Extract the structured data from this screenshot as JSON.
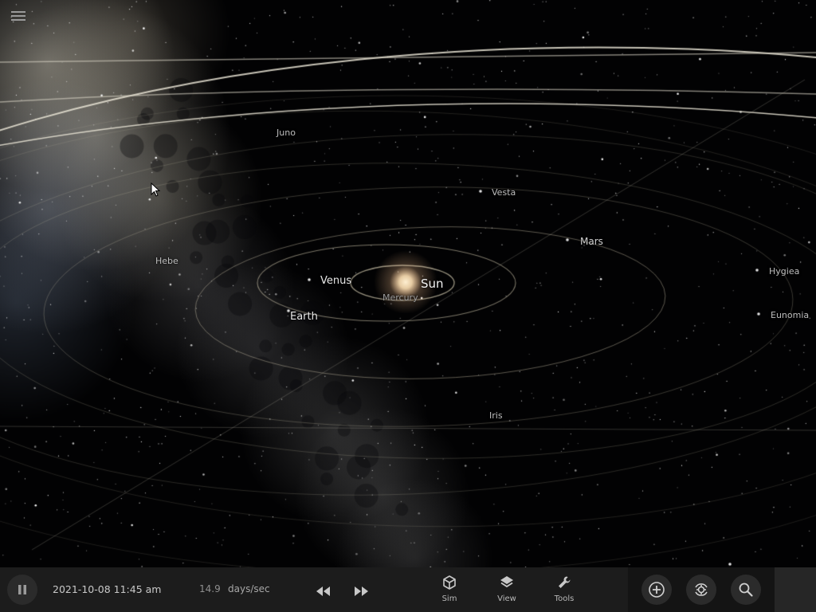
{
  "sky": {
    "labels": {
      "sun": "Sun",
      "mercury": "Mercury",
      "venus": "Venus",
      "earth": "Earth",
      "mars": "Mars",
      "vesta": "Vesta",
      "juno": "Juno",
      "hebe": "Hebe",
      "hygiea": "Hygiea",
      "eunomia": "Eunomia",
      "iris": "Iris"
    }
  },
  "toolbar": {
    "datetime": "2021-10-08 11:45 am",
    "speed_value": "14.9",
    "speed_unit": "days/sec",
    "sim_label": "Sim",
    "view_label": "View",
    "tools_label": "Tools"
  },
  "icons": {
    "menu": "menu-icon",
    "pause": "pause-icon",
    "rewind": "rewind-icon",
    "fast_forward": "fast-forward-icon",
    "sim": "cube-icon",
    "view": "layers-icon",
    "tools": "wrench-icon",
    "add": "plus-circle-icon",
    "recenter": "recenter-icon",
    "search": "search-icon"
  },
  "colors": {
    "toolbar_bg": "#1c1c1c",
    "orbit_line": "#c9c2a8",
    "sun_glow": "#ffe8c0"
  }
}
